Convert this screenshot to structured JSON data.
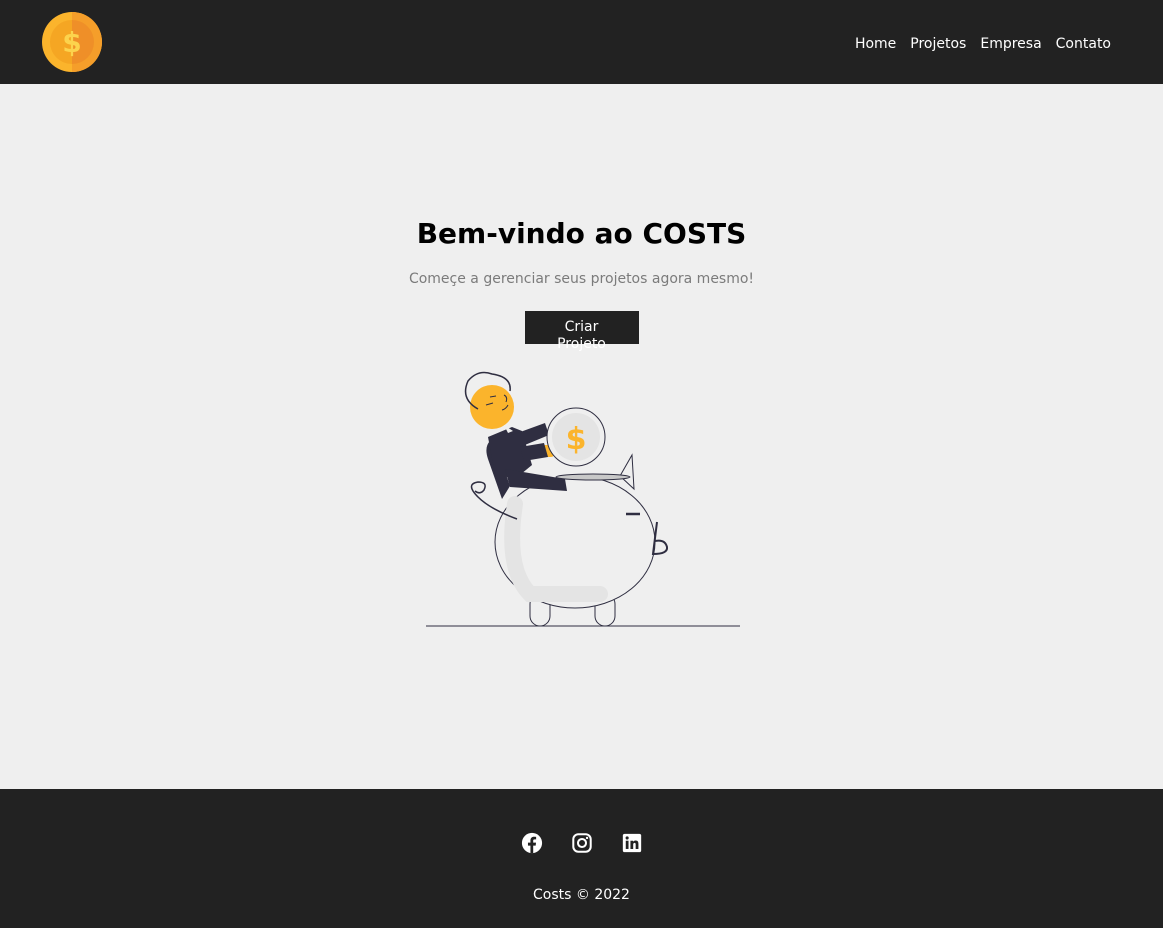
{
  "navbar": {
    "logo_icon": "coin-dollar-icon",
    "links": [
      "Home",
      "Projetos",
      "Empresa",
      "Contato"
    ]
  },
  "hero": {
    "title": "Bem-vindo ao COSTS",
    "subtitle": "Começe a gerenciar seus projetos agora mesmo!",
    "cta_label": "Criar Projeto",
    "illustration": "savings-piggy-bank-illustration"
  },
  "footer": {
    "social": [
      "facebook-icon",
      "instagram-icon",
      "linkedin-icon"
    ],
    "copyright": "Costs © 2022"
  },
  "colors": {
    "dark": "#222222",
    "background": "#efefef",
    "accent": "#fbb42c",
    "text_muted": "#7b7b7b"
  }
}
